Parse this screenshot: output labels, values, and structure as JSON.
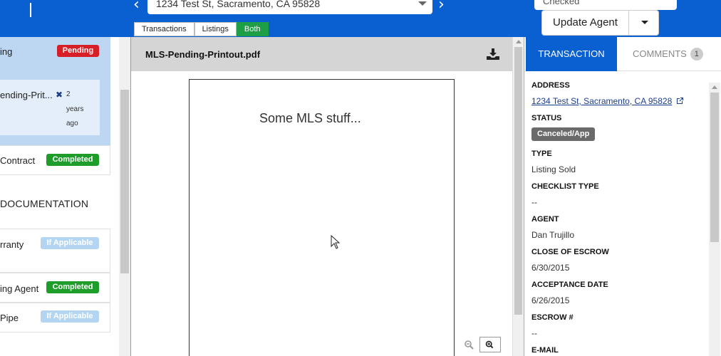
{
  "topbar": {
    "address_value": "1234 Test St, Sacramento, CA 95828",
    "status_value": "Checked",
    "filters": [
      "Transactions",
      "Listings",
      "Both"
    ],
    "active_filter": "Both",
    "update_label": "Update Agent"
  },
  "left": {
    "pending_row_label": "ing",
    "pending_badge": "Pending",
    "doc_name": "ending-Prit...",
    "doc_time": [
      "2",
      "years",
      "ago"
    ],
    "rows": [
      {
        "label": "Contract",
        "badge": "Completed"
      },
      {
        "label": "rranty",
        "badge": "If Applicable"
      },
      {
        "label": "ing Agent",
        "badge": "Completed"
      },
      {
        "label": "Pipe",
        "badge": "If Applicable"
      }
    ],
    "section_heading": "DOCUMENTATION"
  },
  "viewer": {
    "file_name": "MLS-Pending-Printout.pdf",
    "page_text": "Some MLS stuff..."
  },
  "right": {
    "tabs": {
      "transaction": "TRANSACTION",
      "comments": "COMMENTS",
      "comment_count": "1"
    },
    "fields": [
      {
        "label": "ADDRESS",
        "value": "1234 Test St, Sacramento, CA 95828"
      },
      {
        "label": "STATUS",
        "value": "Canceled/App"
      },
      {
        "label": "TYPE",
        "value": "Listing Sold"
      },
      {
        "label": "CHECKLIST TYPE",
        "value": "--"
      },
      {
        "label": "AGENT",
        "value": "Dan Trujillo"
      },
      {
        "label": "CLOSE OF ESCROW",
        "value": "6/30/2015"
      },
      {
        "label": "ACCEPTANCE DATE",
        "value": "6/26/2015"
      },
      {
        "label": "ESCROW #",
        "value": "--"
      },
      {
        "label": "E-MAIL",
        "value": ""
      }
    ]
  },
  "colors": {
    "brand_blue": "#0a5fd1",
    "pending_red": "#d61f26",
    "completed_green": "#1f9d2a",
    "filter_active_green": "#1e9e47",
    "status_gray": "#6a6a6a"
  },
  "icons": [
    "chevron-left-icon",
    "chevron-right-icon",
    "download-icon",
    "external-link-icon",
    "remove-x-icon",
    "zoom-out-icon",
    "zoom-in-icon",
    "mouse-pointer-icon"
  ]
}
